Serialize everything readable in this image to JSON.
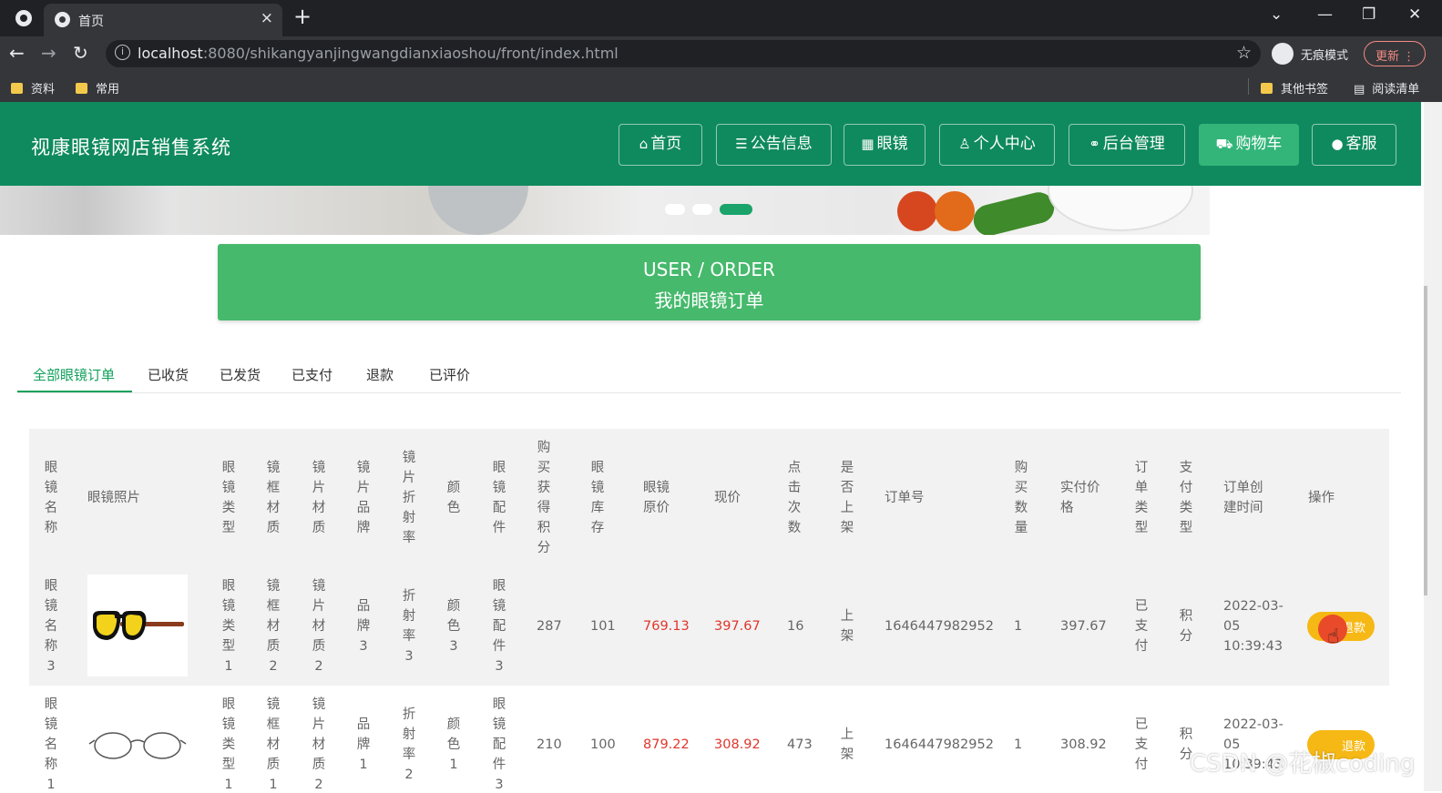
{
  "browser": {
    "tab_title": "首页",
    "tab_close": "×",
    "new_tab": "+",
    "url_host": "localhost",
    "url_path": ":8080/shikangyanjingwangdianxiaoshou/front/index.html",
    "incognito_label": "无痕模式",
    "update_label": "更新",
    "bookmarks": [
      "资料",
      "常用"
    ],
    "bookmarks_right": [
      "其他书签",
      "阅读清单"
    ]
  },
  "site": {
    "brand": "视康眼镜网店销售系统",
    "nav": [
      {
        "label": "首页",
        "icon": "home-icon",
        "glyph": "⌂"
      },
      {
        "label": "公告信息",
        "icon": "notice-icon",
        "glyph": "☰"
      },
      {
        "label": "眼镜",
        "icon": "grid-icon",
        "glyph": "▦"
      },
      {
        "label": "个人中心",
        "icon": "user-icon",
        "glyph": "♙"
      },
      {
        "label": "后台管理",
        "icon": "link-icon",
        "glyph": "⚭"
      },
      {
        "label": "购物车",
        "icon": "cart-icon",
        "glyph": "⛟"
      },
      {
        "label": "客服",
        "icon": "chat-icon",
        "glyph": "●"
      }
    ],
    "accent_color": "#0f8a5e"
  },
  "page": {
    "title_en": "USER / ORDER",
    "title_zh": "我的眼镜订单"
  },
  "order_tabs": [
    "全部眼镜订单",
    "已收货",
    "已发货",
    "已支付",
    "退款",
    "已评价"
  ],
  "table": {
    "headers": [
      "眼镜名称",
      "眼镜照片",
      "眼镜类型",
      "镜框材质",
      "镜片材质",
      "镜片品牌",
      "镜片折射率",
      "颜色",
      "眼镜配件",
      "购买获得积分",
      "眼镜库存",
      "眼镜原价",
      "现价",
      "点击次数",
      "是否上架",
      "订单号",
      "购买数量",
      "实付价格",
      "订单类型",
      "支付类型",
      "订单创建时间",
      "操作"
    ],
    "rows": [
      {
        "name": "眼镜名称3",
        "type": "眼镜类型1",
        "frame": "镜框材质2",
        "lens": "镜片材质2",
        "brand": "品牌3",
        "refraction": "折射率3",
        "color": "颜色3",
        "accessory": "眼镜配件3",
        "points": "287",
        "stock": "101",
        "orig_price": "769.13",
        "price": "397.67",
        "clicks": "16",
        "on_shelf": "上架",
        "order_no": "1646447982952",
        "qty": "1",
        "paid": "397.67",
        "order_type": "已支付",
        "pay_type": "积分",
        "created": "2022-03-05 10:39:43",
        "action": "退款"
      },
      {
        "name": "眼镜名称1",
        "type": "眼镜类型1",
        "frame": "镜框材质1",
        "lens": "镜片材质2",
        "brand": "品牌1",
        "refraction": "折射率2",
        "color": "颜色1",
        "accessory": "眼镜配件3",
        "points": "210",
        "stock": "100",
        "orig_price": "879.22",
        "price": "308.92",
        "clicks": "473",
        "on_shelf": "上架",
        "order_no": "1646447982952",
        "qty": "1",
        "paid": "308.92",
        "order_type": "已支付",
        "pay_type": "积分",
        "created": "2022-03-05 10:39:43",
        "action": "退款"
      }
    ]
  },
  "watermark": "CSDN @花椒coding"
}
